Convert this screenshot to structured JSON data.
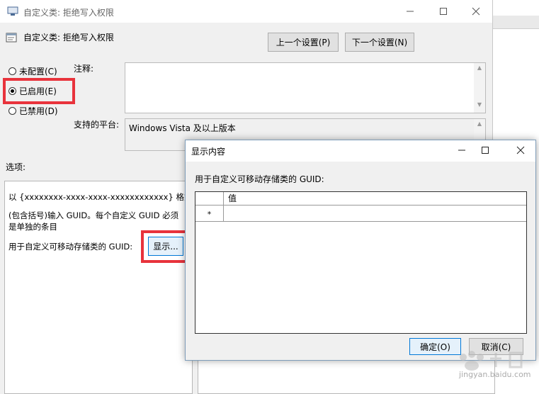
{
  "window": {
    "title": "自定义类: 拒绝写入权限",
    "header": "自定义类: 拒绝写入权限",
    "prev_label": "上一个设置(P)",
    "next_label": "下一个设置(N)"
  },
  "state": {
    "not_configured": "未配置(C)",
    "enabled": "已启用(E)",
    "disabled": "已禁用(D)",
    "selected": "enabled"
  },
  "comment_label": "注释:",
  "platform": {
    "label": "支持的平台:",
    "value": "Windows Vista 及以上版本"
  },
  "options": {
    "label": "选项:",
    "desc_line1": "以 {xxxxxxxx-xxxx-xxxx-xxxxxxxxxxxx} 格式",
    "desc_line2": "(包含括号)输入 GUID。每个自定义 GUID 必须是单独的条目",
    "guid_label": "用于自定义可移动存储类的 GUID:",
    "show_button": "显示..."
  },
  "dialog": {
    "title": "显示内容",
    "label": "用于自定义可移动存储类的 GUID:",
    "column_header": "值",
    "new_row_marker": "*",
    "ok": "确定(O)",
    "cancel": "取消(C)"
  },
  "watermark": "jingyan.baidu.com",
  "colors": {
    "highlight": "#e8333c",
    "focus_blue": "#0078d7"
  }
}
